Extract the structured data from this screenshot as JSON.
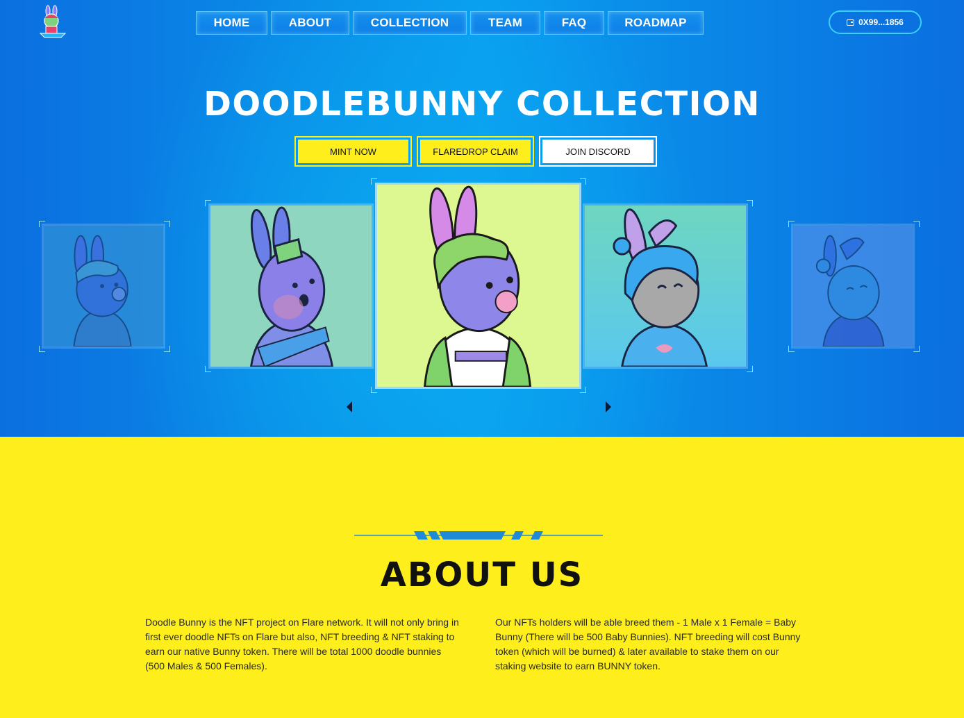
{
  "nav": {
    "items": [
      "HOME",
      "ABOUT",
      "COLLECTION",
      "TEAM",
      "FAQ",
      "ROADMAP"
    ],
    "wallet_label": "0X99...1856"
  },
  "hero": {
    "title": "DOODLEBUNNY COLLECTION",
    "buttons": {
      "mint": "MINT NOW",
      "claim": "FLAREDROP CLAIM",
      "discord": "JOIN DISCORD"
    }
  },
  "carousel": {
    "cards": [
      "bunny-bubblegum-faded",
      "bunny-green-mohawk",
      "bunny-bubblegum-center",
      "bunny-blue-hair",
      "bunny-bun-faded"
    ]
  },
  "about": {
    "title": "ABOUT US",
    "left_text": "Doodle Bunny is the NFT project on Flare network. It will not only bring in first ever doodle NFTs on Flare but also, NFT breeding & NFT staking to earn our native Bunny token. There will be total 1000 doodle bunnies (500 Males & 500 Females).",
    "right_text": "Our NFTs holders will be able breed them - 1 Male x 1 Female = Baby Bunny (There will be 500 Baby Bunnies). NFT breeding will cost Bunny token (which will be burned) & later available to stake them on our staking website to earn BUNNY token."
  },
  "colors": {
    "hero_blue": "#0a8fe8",
    "accent_yellow": "#fdee1c",
    "border_cyan": "#39d0ff"
  }
}
